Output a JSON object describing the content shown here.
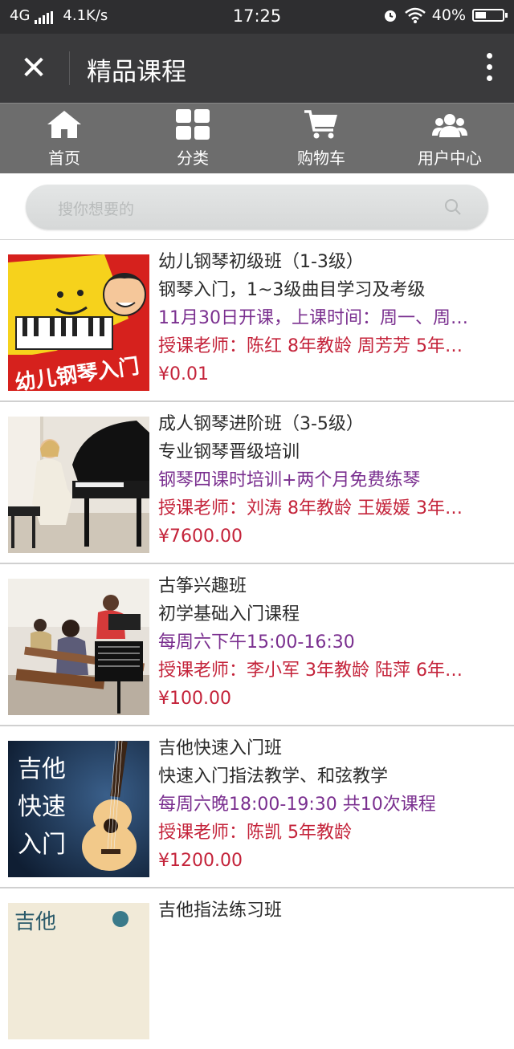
{
  "status_bar": {
    "network": "4G",
    "speed": "4.1K/s",
    "time": "17:25",
    "battery": "40%",
    "battery_level": 0.4
  },
  "header": {
    "close_icon": "close-icon",
    "title": "精品课程",
    "more_icon": "more-vertical-icon"
  },
  "nav": [
    {
      "label": "首页",
      "icon": "home-icon"
    },
    {
      "label": "分类",
      "icon": "grid-icon"
    },
    {
      "label": "购物车",
      "icon": "cart-icon"
    },
    {
      "label": "用户中心",
      "icon": "users-icon"
    }
  ],
  "search": {
    "placeholder": "搜你想要的",
    "icon": "search-icon"
  },
  "colors": {
    "schedule": "#7a2f8f",
    "teacher": "#c4233a",
    "price": "#c4233a",
    "nav_bg": "#6d6d6d",
    "header_bg": "#3a3a3c"
  },
  "courses": [
    {
      "title": "幼儿钢琴初级班（1-3级）",
      "subtitle": "钢琴入门，1~3级曲目学习及考级",
      "schedule": "11月30日开课，上课时间：周一、周…",
      "teacher": "授课老师：陈红 8年教龄 周芳芳 5年…",
      "price": "¥0.01"
    },
    {
      "title": "成人钢琴进阶班（3-5级）",
      "subtitle": "专业钢琴晋级培训",
      "schedule": "钢琴四课时培训+两个月免费练琴",
      "teacher": "授课老师：刘涛 8年教龄 王媛媛 3年…",
      "price": "¥7600.00"
    },
    {
      "title": "古筝兴趣班",
      "subtitle": "初学基础入门课程",
      "schedule": "每周六下午15:00-16:30",
      "teacher": "授课老师：李小军 3年教龄 陆萍 6年…",
      "price": "¥100.00"
    },
    {
      "title": "吉他快速入门班",
      "subtitle": "快速入门指法教学、和弦教学",
      "schedule": "每周六晚18:00-19:30 共10次课程",
      "teacher": "授课老师：陈凯 5年教龄",
      "price": "¥1200.00"
    },
    {
      "title": "吉他指法练习班"
    }
  ],
  "thumb_text": {
    "piano_kids": "幼儿钢琴入门",
    "guitar_fast": [
      "吉他",
      "快速",
      "入门"
    ],
    "guitar_partial": "吉他"
  }
}
